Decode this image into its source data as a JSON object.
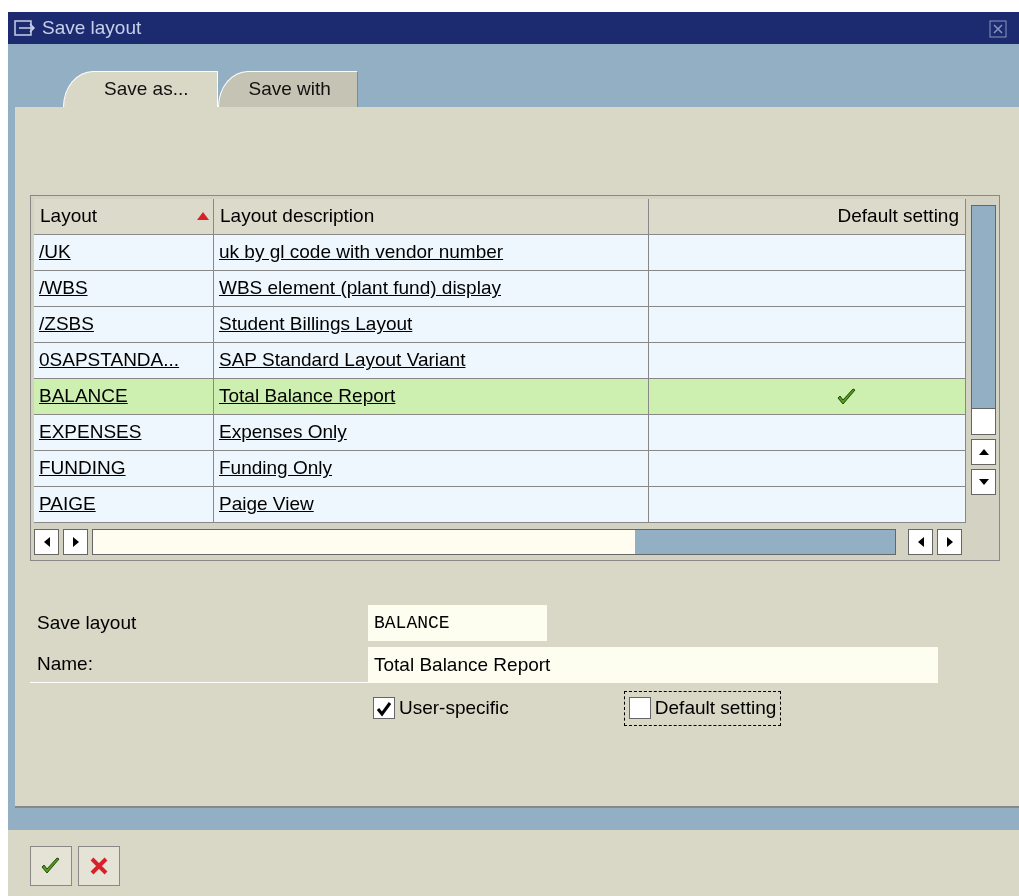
{
  "window": {
    "title": "Save layout"
  },
  "tabs": [
    {
      "label": "Save as...",
      "selected": true
    },
    {
      "label": "Save with",
      "selected": false
    }
  ],
  "table": {
    "columns": [
      {
        "label": "Layout",
        "sorted": true
      },
      {
        "label": "Layout description",
        "sorted": false
      },
      {
        "label": "Default setting",
        "sorted": false
      }
    ],
    "rows": [
      {
        "layout": "/UK",
        "description": "uk by gl code with vendor number",
        "default": false,
        "selected": false
      },
      {
        "layout": "/WBS",
        "description": "WBS element (plant fund) display",
        "default": false,
        "selected": false
      },
      {
        "layout": "/ZSBS",
        "description": "Student Billings Layout",
        "default": false,
        "selected": false
      },
      {
        "layout": "0SAPSTANDA...",
        "description": "SAP Standard Layout Variant",
        "default": false,
        "selected": false
      },
      {
        "layout": "BALANCE",
        "description": "Total Balance Report",
        "default": true,
        "selected": true
      },
      {
        "layout": "EXPENSES",
        "description": "Expenses Only",
        "default": false,
        "selected": false
      },
      {
        "layout": "FUNDING",
        "description": "Funding Only",
        "default": false,
        "selected": false
      },
      {
        "layout": "PAIGE",
        "description": "Paige View",
        "default": false,
        "selected": false
      }
    ]
  },
  "form": {
    "fields": [
      {
        "label": "Save layout",
        "value": "BALANCE",
        "kind": "code"
      },
      {
        "label": "Name:",
        "value": "Total Balance Report",
        "kind": "text"
      }
    ],
    "checkboxes": [
      {
        "label": "User-specific",
        "checked": true,
        "focused": false
      },
      {
        "label": "Default setting",
        "checked": false,
        "focused": true
      }
    ]
  },
  "buttons": [
    {
      "kind": "confirm"
    },
    {
      "kind": "cancel"
    }
  ]
}
